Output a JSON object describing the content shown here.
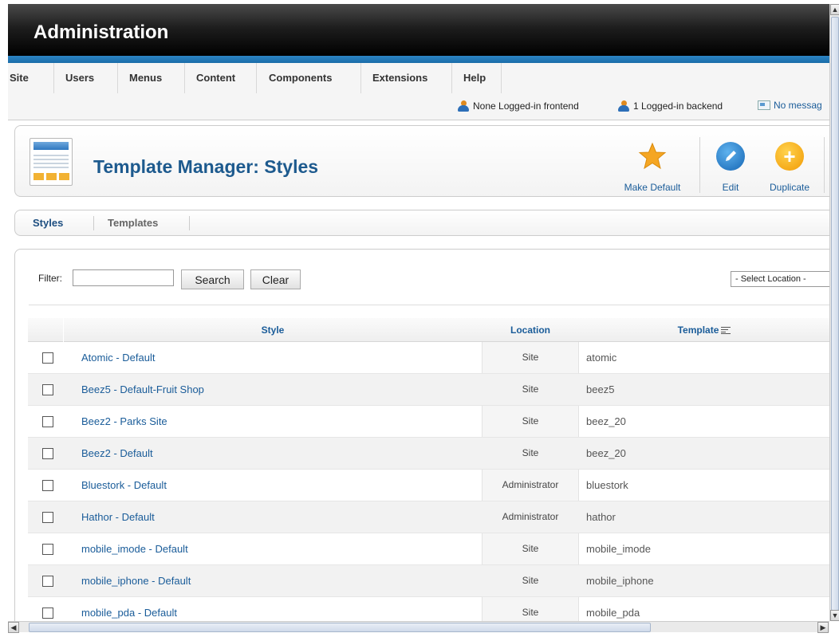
{
  "header": {
    "title": "Administration"
  },
  "menu": [
    "Site",
    "Users",
    "Menus",
    "Content",
    "Components",
    "Extensions",
    "Help"
  ],
  "status": {
    "frontend": "None Logged-in frontend",
    "backend": "1 Logged-in backend",
    "messages": "No messag"
  },
  "toolbar": {
    "title": "Template Manager: Styles",
    "make_default": "Make Default",
    "edit": "Edit",
    "duplicate": "Duplicate"
  },
  "submenu": {
    "styles": "Styles",
    "templates": "Templates"
  },
  "filter": {
    "label": "Filter:",
    "value": "",
    "search": "Search",
    "clear": "Clear",
    "location": "- Select Location -"
  },
  "table": {
    "columns": {
      "style": "Style",
      "location": "Location",
      "template": "Template"
    },
    "rows": [
      {
        "style": "Atomic - Default",
        "location": "Site",
        "template": "atomic"
      },
      {
        "style": "Beez5 - Default-Fruit Shop",
        "location": "Site",
        "template": "beez5"
      },
      {
        "style": "Beez2 - Parks Site",
        "location": "Site",
        "template": "beez_20"
      },
      {
        "style": "Beez2 - Default",
        "location": "Site",
        "template": "beez_20"
      },
      {
        "style": "Bluestork - Default",
        "location": "Administrator",
        "template": "bluestork"
      },
      {
        "style": "Hathor - Default",
        "location": "Administrator",
        "template": "hathor"
      },
      {
        "style": "mobile_imode - Default",
        "location": "Site",
        "template": "mobile_imode"
      },
      {
        "style": "mobile_iphone - Default",
        "location": "Site",
        "template": "mobile_iphone"
      },
      {
        "style": "mobile_pda - Default",
        "location": "Site",
        "template": "mobile_pda"
      }
    ]
  },
  "colors": {
    "accent": "#1a5c99",
    "header_bar": "#1a6ca8",
    "star": "#f5a623",
    "edit_icon": "#1566b4",
    "duplicate_icon": "#f19a05"
  }
}
